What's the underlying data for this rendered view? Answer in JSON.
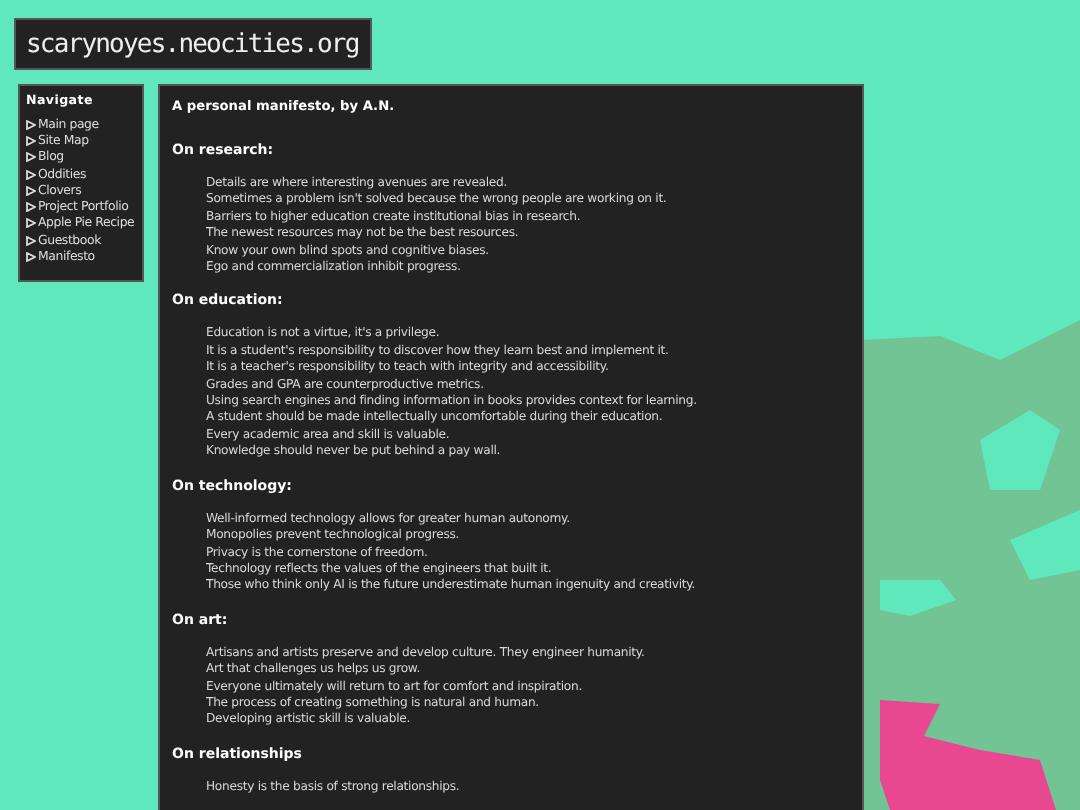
{
  "site_title": "scarynoyes.neocities.org",
  "nav": {
    "heading": "Navigate",
    "items": [
      {
        "label": "Main page"
      },
      {
        "label": "Site Map"
      },
      {
        "label": "Blog"
      },
      {
        "label": "Oddities"
      },
      {
        "label": "Clovers"
      },
      {
        "label": "Project Portfolio"
      },
      {
        "label": "Apple Pie Recipe"
      },
      {
        "label": "Guestbook"
      },
      {
        "label": "Manifesto"
      }
    ]
  },
  "article": {
    "title": "A personal manifesto, by A.N.",
    "sections": [
      {
        "heading": "On research:",
        "lines": [
          "Details are where interesting avenues are revealed.",
          "Sometimes a problem isn't solved because the wrong people are working on it.",
          "Barriers to higher education create institutional bias in research.",
          "The newest resources may not be the best resources.",
          "Know your own blind spots and cognitive biases.",
          "Ego and commercialization inhibit progress."
        ]
      },
      {
        "heading": "On education:",
        "lines": [
          "Education is not a virtue, it's a privilege.",
          "It is a student's responsibility to discover how they learn best and implement it.",
          "It is a teacher's responsibility to teach with integrity and accessibility.",
          "Grades and GPA are counterproductive metrics.",
          "Using search engines and finding information in books provides context for learning.",
          "A student should be made intellectually uncomfortable during their education.",
          "Every academic area and skill is valuable.",
          "Knowledge should never be put behind a pay wall."
        ]
      },
      {
        "heading": "On technology:",
        "lines": [
          "Well-informed technology allows for greater human autonomy.",
          "Monopolies prevent technological progress.",
          "Privacy is the cornerstone of freedom.",
          "Technology reflects the values of the engineers that built it.",
          "Those who think only AI is the future underestimate human ingenuity and creativity."
        ]
      },
      {
        "heading": "On art:",
        "lines": [
          "Artisans and artists preserve and develop culture. They engineer humanity.",
          "Art that challenges us helps us grow.",
          "Everyone ultimately will return to art for comfort and inspiration.",
          "The process of creating something is natural and human.",
          "Developing artistic skill is valuable."
        ]
      },
      {
        "heading": "On relationships",
        "lines": [
          "Honesty is the basis of strong relationships."
        ]
      }
    ]
  }
}
